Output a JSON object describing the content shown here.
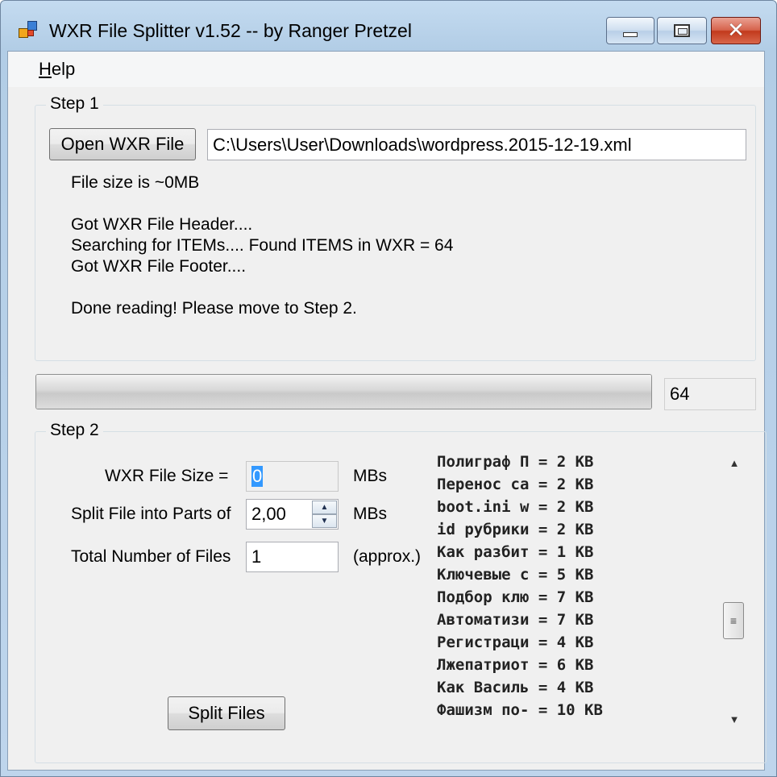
{
  "window": {
    "title": "WXR File Splitter v1.52 -- by Ranger Pretzel",
    "minimize_icon": "minimize-icon",
    "maximize_icon": "maximize-icon",
    "close_glyph": "✕"
  },
  "menu": {
    "help": "Help"
  },
  "step1": {
    "legend": "Step 1",
    "open_button": "Open WXR File",
    "file_path": "C:\\Users\\User\\Downloads\\wordpress.2015-12-19.xml",
    "log": {
      "line1": "File size is ~0MB",
      "line2": "Got WXR File Header....",
      "line3": "Searching for ITEMs.... Found ITEMS in WXR = 64",
      "line4": "Got WXR File Footer....",
      "line5": "Done reading! Please move to Step 2."
    }
  },
  "progress": {
    "value_fraction": 1.0,
    "count": "64"
  },
  "step2": {
    "legend": "Step 2",
    "size_label": "WXR File Size =",
    "size_value": "0",
    "parts_label": "Split File into Parts of",
    "parts_value": "2,00",
    "total_label": "Total Number of Files",
    "total_value": "1",
    "unit_mb1": "MBs",
    "unit_mb2": "MBs",
    "unit_approx": "(approx.)",
    "split_button": "Split Files",
    "spin_up": "▲",
    "spin_down": "▼",
    "items": [
      "Полиграф П = 2 KB",
      "Перенос са = 2 KB",
      "boot.ini w = 2 KB",
      "id рубрики = 2 KB",
      "Как разбит = 1 KB",
      "Ключевые с = 5 KB",
      "Подбор клю = 7 KB",
      "Автоматизи = 7 KB",
      "Регистраци = 4 KB",
      "Лжепатриот = 6 KB",
      "Как Василь = 4 KB",
      "Фашизм по- = 10 KB"
    ],
    "scroll_up": "▲",
    "scroll_down": "▼",
    "scroll_thumb_grip": "≡"
  }
}
